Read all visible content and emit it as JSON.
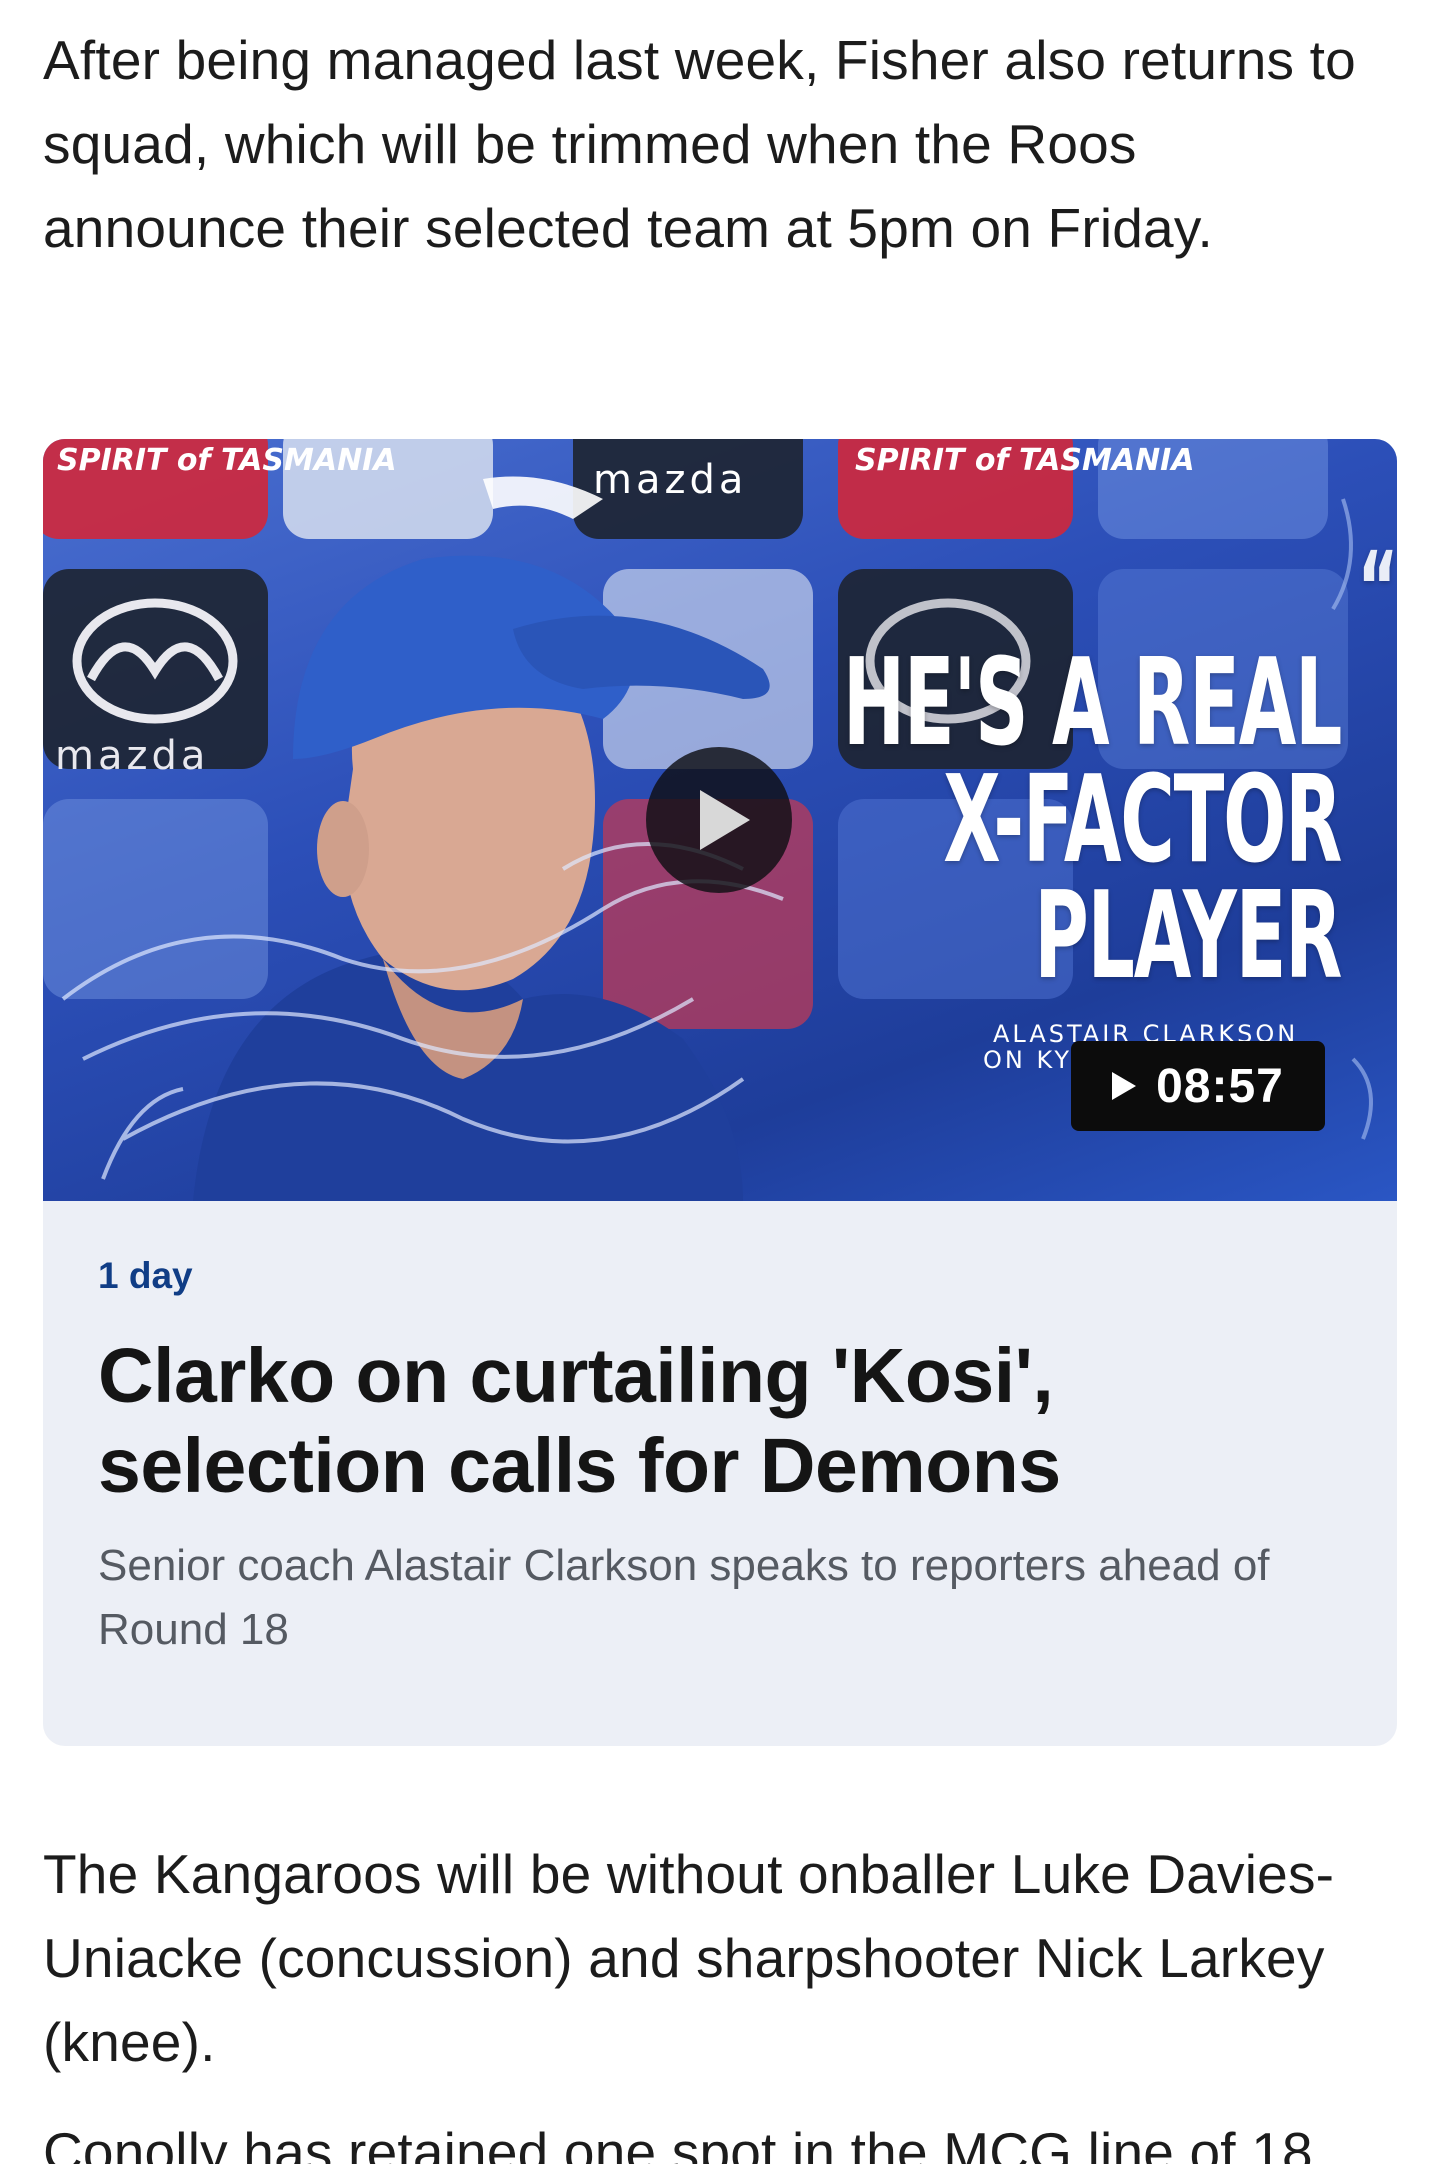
{
  "article": {
    "paragraph_1": "After being managed last week, Fisher also returns to squad, which will be trimmed when the Roos announce their selected team at 5pm on Friday.",
    "paragraph_2": "The Kangaroos will be without onballer Luke Davies-Uniacke (concussion) and sharpshooter Nick Larkey (knee).",
    "paragraph_3_partial": "Conolly has retained one spot in the MCG line of 18"
  },
  "video_card": {
    "thumbnail": {
      "quote": {
        "line_1": "HE'S A REAL",
        "line_2": "X-FACTOR",
        "line_3": "PLAYER",
        "quote_mark": "“"
      },
      "attribution_line_1": "ALASTAIR CLARKSON",
      "attribution_line_2": "ON KY",
      "sponsor_1": "SPIRIT of TASMANIA",
      "sponsor_2": "mazda",
      "play_icon": "play-icon",
      "colors": {
        "background_blue": "#2c4fb8",
        "sponsor_red": "#d2283a",
        "mazda_tile": "#1d2430"
      }
    },
    "duration": "08:57",
    "timestamp": "1 day",
    "headline": "Clarko on curtailing 'Kosi', selection calls for Demons",
    "summary": "Senior coach Alastair Clarkson speaks to reporters ahead of Round 18",
    "colors": {
      "card_background": "#eceff6",
      "timestamp": "#103d86",
      "headline": "#151515",
      "summary": "#555a62"
    }
  }
}
